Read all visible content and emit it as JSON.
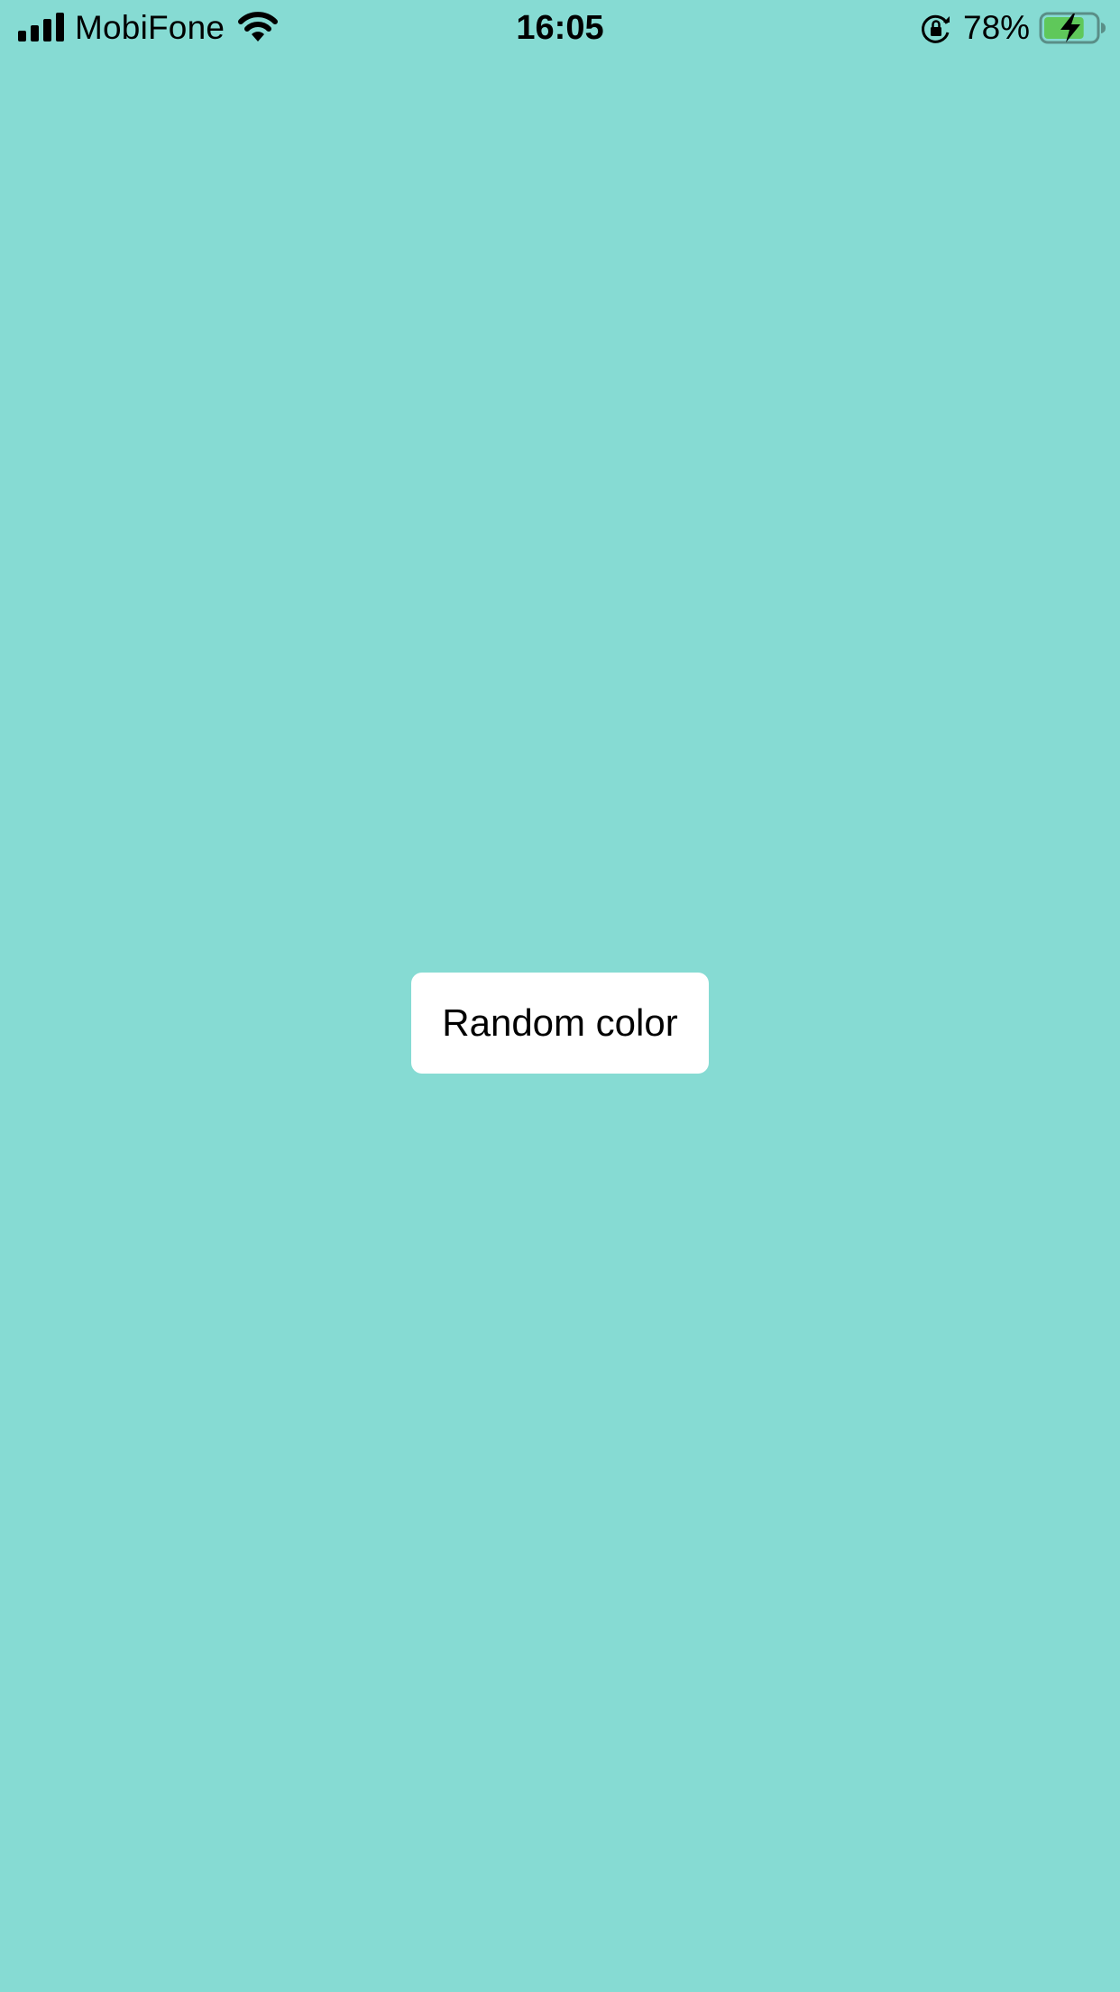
{
  "status_bar": {
    "carrier": "MobiFone",
    "time": "16:05",
    "battery_percent": "78%",
    "battery_level": 0.78,
    "battery_charging": true,
    "icons": [
      "signal-icon",
      "wifi-icon",
      "rotation-lock-icon",
      "battery-icon"
    ]
  },
  "main": {
    "background_color": "#86dbd3",
    "button_label": "Random color"
  },
  "colors": {
    "background": "#86dbd3",
    "button": "#ffffff",
    "battery_fill": "#5fc85a"
  }
}
